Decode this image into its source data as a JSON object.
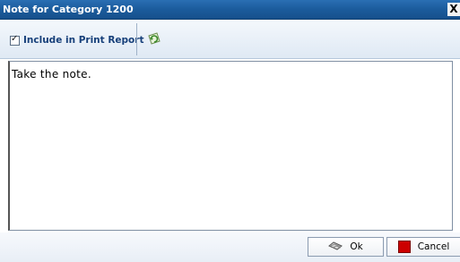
{
  "window": {
    "title": "Note for Category 1200",
    "close_label": "X"
  },
  "toolbar": {
    "include_label": "Include in Print Report",
    "include_checked": true,
    "refresh_icon": "refresh-icon"
  },
  "note": {
    "text": "Take the note."
  },
  "footer": {
    "ok_label": "Ok",
    "cancel_label": "Cancel",
    "ok_icon": "ok-icon",
    "cancel_icon": "cancel-icon",
    "cancel_color": "#cc0000"
  }
}
